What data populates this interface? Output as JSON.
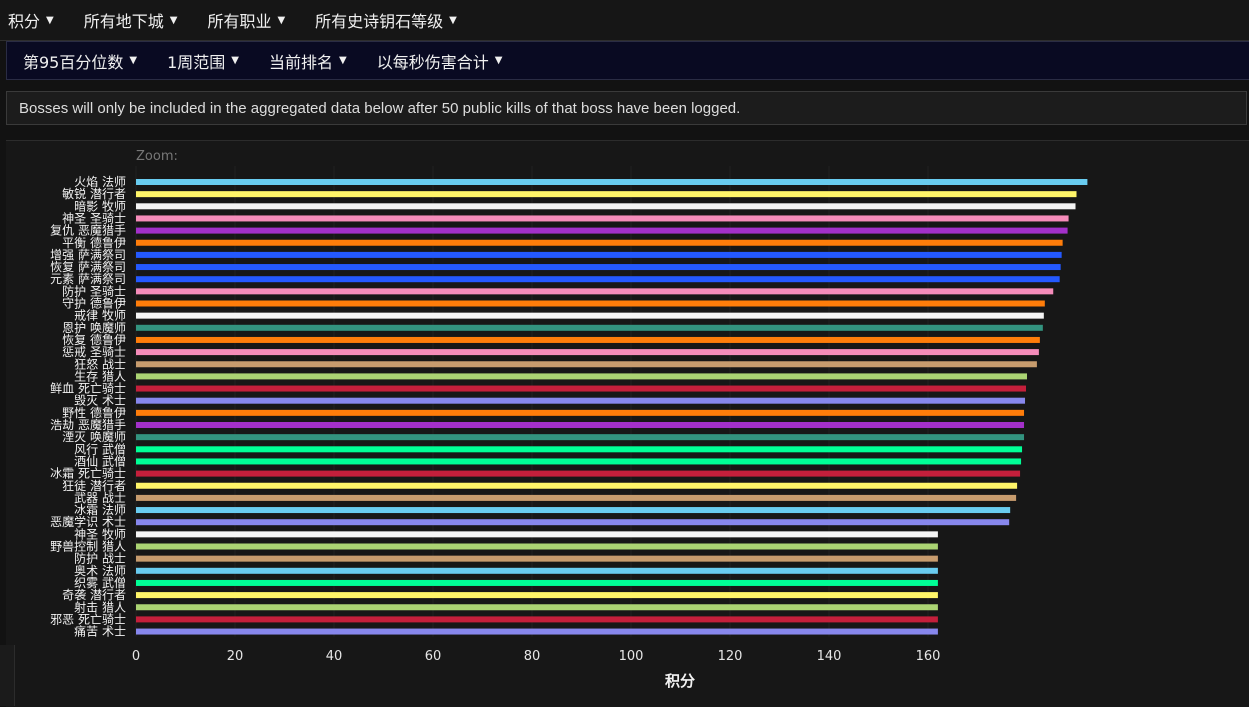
{
  "topbar": {
    "items": [
      {
        "label": "积分"
      },
      {
        "label": "所有地下城"
      },
      {
        "label": "所有职业"
      },
      {
        "label": "所有史诗钥石等级"
      }
    ]
  },
  "subbar": {
    "items": [
      {
        "label": "第95百分位数"
      },
      {
        "label": "1周范围"
      },
      {
        "label": "当前排名"
      },
      {
        "label": "以每秒伤害合计"
      }
    ]
  },
  "notice": {
    "text": "Bosses will only be included in the aggregated data below after 50 public kills of that boss have been logged."
  },
  "chart": {
    "zoom_label": "Zoom:"
  },
  "chart_data": {
    "type": "bar",
    "orientation": "horizontal",
    "xlabel": "积分",
    "xlim": [
      0,
      200
    ],
    "xticks": [
      0,
      20,
      40,
      60,
      80,
      100,
      120,
      140,
      160
    ],
    "grid": true,
    "categories": [
      "火焰 法师",
      "敏锐 潜行者",
      "暗影 牧师",
      "神圣 圣骑士",
      "复仇 恶魔猎手",
      "平衡 德鲁伊",
      "增强 萨满祭司",
      "恢复 萨满祭司",
      "元素 萨满祭司",
      "防护 圣骑士",
      "守护 德鲁伊",
      "戒律 牧师",
      "恩护 唤魔师",
      "恢复 德鲁伊",
      "惩戒 圣骑士",
      "狂怒 战士",
      "生存 猎人",
      "鲜血 死亡骑士",
      "毁灭 术士",
      "野性 德鲁伊",
      "浩劫 恶魔猎手",
      "湮灭 唤魔师",
      "风行 武僧",
      "酒仙 武僧",
      "冰霜 死亡骑士",
      "狂徒 潜行者",
      "武器 战士",
      "冰霜 法师",
      "恶魔学识 术士",
      "神圣 牧师",
      "野兽控制 猎人",
      "防护 战士",
      "奥术 法师",
      "织雾 武僧",
      "奇袭 潜行者",
      "射击 猎人",
      "邪恶 死亡骑士",
      "痛苦 术士"
    ],
    "values": [
      192.2,
      190.0,
      189.8,
      188.4,
      188.2,
      187.2,
      187.0,
      186.8,
      186.6,
      185.3,
      183.6,
      183.4,
      183.2,
      182.6,
      182.4,
      182.0,
      180.0,
      179.8,
      179.6,
      179.4,
      179.4,
      179.4,
      179.0,
      178.8,
      178.6,
      178.0,
      177.8,
      176.6,
      176.4,
      162.0,
      162.0,
      162.0,
      162.0,
      162.0,
      162.0,
      162.0,
      162.0,
      162.0
    ],
    "colors": [
      "#69ccf0",
      "#fff569",
      "#f4f4f4",
      "#f58cba",
      "#a330c9",
      "#ff7d0a",
      "#2459ff",
      "#2459ff",
      "#2459ff",
      "#f58cba",
      "#ff7d0a",
      "#f4f4f4",
      "#33937f",
      "#ff7d0a",
      "#f58cba",
      "#c79c6e",
      "#abd473",
      "#c41f3b",
      "#8787ed",
      "#ff7d0a",
      "#a330c9",
      "#33937f",
      "#00ff96",
      "#00ff96",
      "#c41f3b",
      "#fff569",
      "#c79c6e",
      "#69ccf0",
      "#8787ed",
      "#f4f4f4",
      "#abd473",
      "#c79c6e",
      "#69ccf0",
      "#00ff96",
      "#fff569",
      "#abd473",
      "#c41f3b",
      "#8787ed"
    ]
  }
}
